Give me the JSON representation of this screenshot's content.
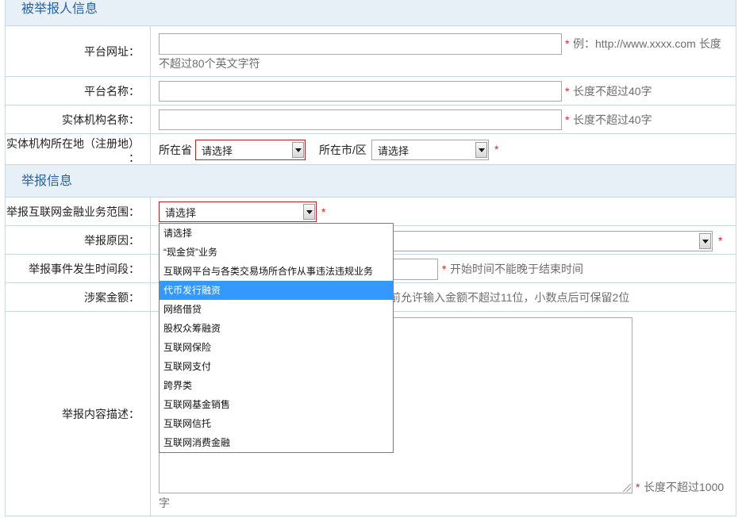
{
  "sections": {
    "reported_party": "被举报人信息",
    "report_info": "举报信息"
  },
  "platform_url": {
    "label": "平台网址：",
    "value": "",
    "required": "*",
    "hint_line1": "例：http://www.xxxx.com 长度",
    "hint_line2": "不超过80个英文字符"
  },
  "platform_name": {
    "label": "平台名称：",
    "value": "",
    "required": "*",
    "hint": "长度不超过40字"
  },
  "entity_name": {
    "label": "实体机构名称：",
    "value": "",
    "required": "*",
    "hint": "长度不超过40字"
  },
  "entity_location": {
    "label_line1": "实体机构所在地（注册地）",
    "label_line2": "：",
    "province_label": "所在省",
    "province_value": "请选择",
    "city_label": "所在市/区",
    "city_value": "请选择",
    "required": "*"
  },
  "business_scope": {
    "label": "举报互联网金融业务范围：",
    "value": "请选择",
    "required": "*",
    "dropdown_open": true,
    "highlighted_index": 3,
    "options": [
      "请选择",
      "“现金贷”业务",
      "互联网平台与各类交易场所合作从事违法违规业务",
      "代币发行融资",
      "网络借贷",
      "股权众筹融资",
      "互联网保险",
      "互联网支付",
      "跨界类",
      "互联网基金销售",
      "互联网信托",
      "互联网消费金融"
    ]
  },
  "report_reason": {
    "label": "举报原因：",
    "required": "*"
  },
  "event_time_range": {
    "label": "举报事件发生时间段：",
    "value": "",
    "required": "*",
    "hint": "开始时间不能晚于结束时间"
  },
  "amount": {
    "label": "涉案金额：",
    "hint": "前允许输入金额不超过11位，小数点后可保留2位"
  },
  "description": {
    "label": "举报内容描述：",
    "value": "",
    "required": "*",
    "hint_line1": "长度不超过1000",
    "hint_line2": "字"
  },
  "colors": {
    "section_header_bg": "#e8f0f7",
    "section_header_text": "#2a62a0",
    "border": "#c6d8e7",
    "required": "#e31e24",
    "error_border": "#c41e24",
    "option_highlight_bg": "#3399ff",
    "option_highlight_text": "#ffffff"
  },
  "icons": {
    "select_arrow": "chevron-down-icon",
    "textarea_resize": "resize-grip-icon"
  }
}
